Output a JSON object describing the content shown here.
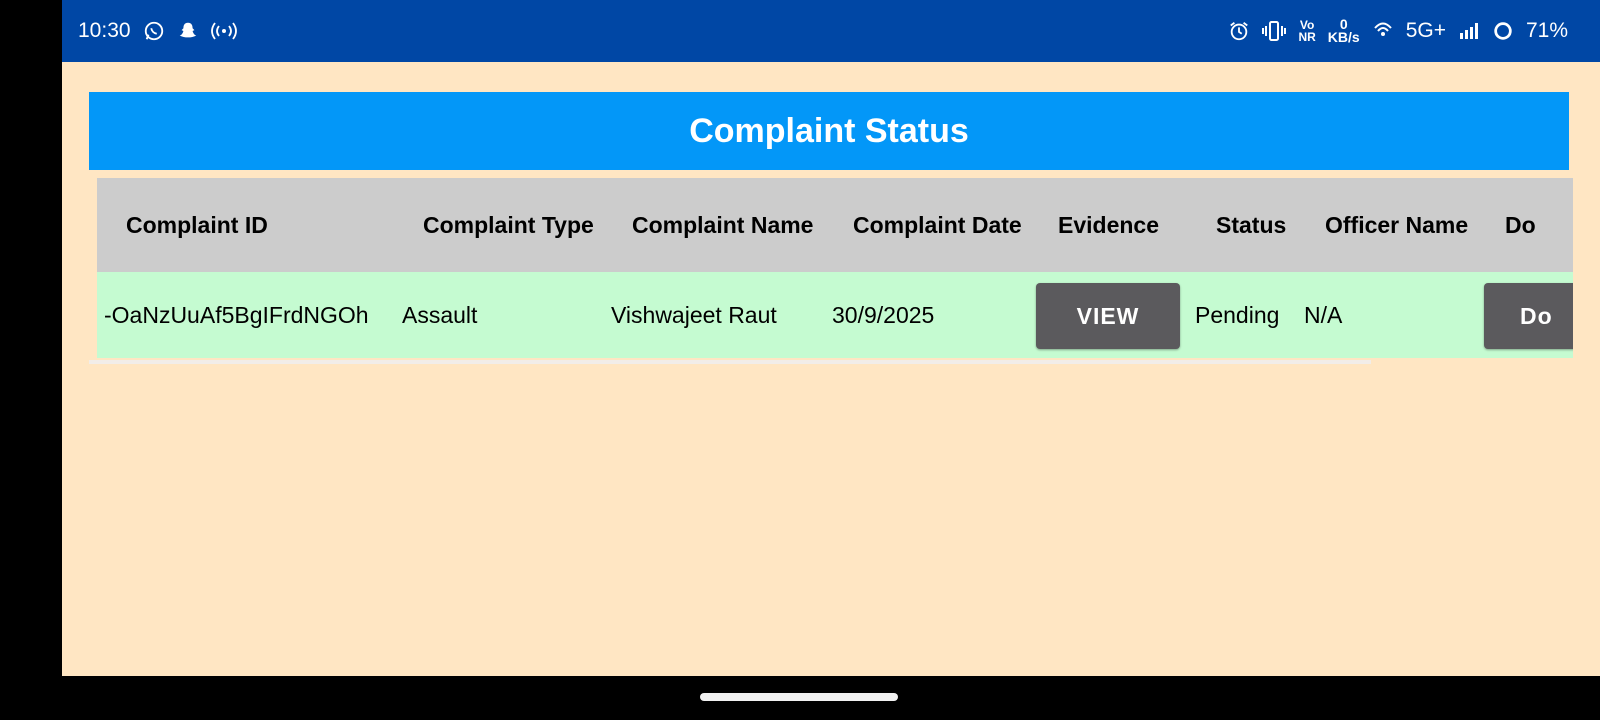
{
  "statusbar": {
    "time": "10:30",
    "left_icons": [
      "whatsapp-icon",
      "snapchat-icon",
      "hotspot-icon"
    ],
    "right_icons": [
      "alarm-icon",
      "vibrate-icon"
    ],
    "volte": "Vo\nNR",
    "speed_value": "0",
    "speed_unit": "KB/s",
    "network": "5G+",
    "battery": "71%"
  },
  "page": {
    "title": "Complaint Status"
  },
  "table": {
    "headers": [
      "Complaint ID",
      "Complaint Type",
      "Complaint Name",
      "Complaint Date",
      "Evidence",
      "Status",
      "Officer Name",
      "Do"
    ],
    "row": {
      "id": "-OaNzUuAf5BgIFrdNGOh",
      "type": "Assault",
      "name": "Vishwajeet Raut",
      "date": "30/9/2025",
      "evidence_button": "VIEW",
      "status": "Pending",
      "officer": "N/A",
      "download_button": "Do"
    }
  },
  "colors": {
    "statusbar": "#0047a5",
    "background": "#ffe6c3",
    "header": "#0397f8",
    "table_head": "#cccccc",
    "row_bg": "#c5fbd1",
    "button": "#5b5a5d"
  }
}
